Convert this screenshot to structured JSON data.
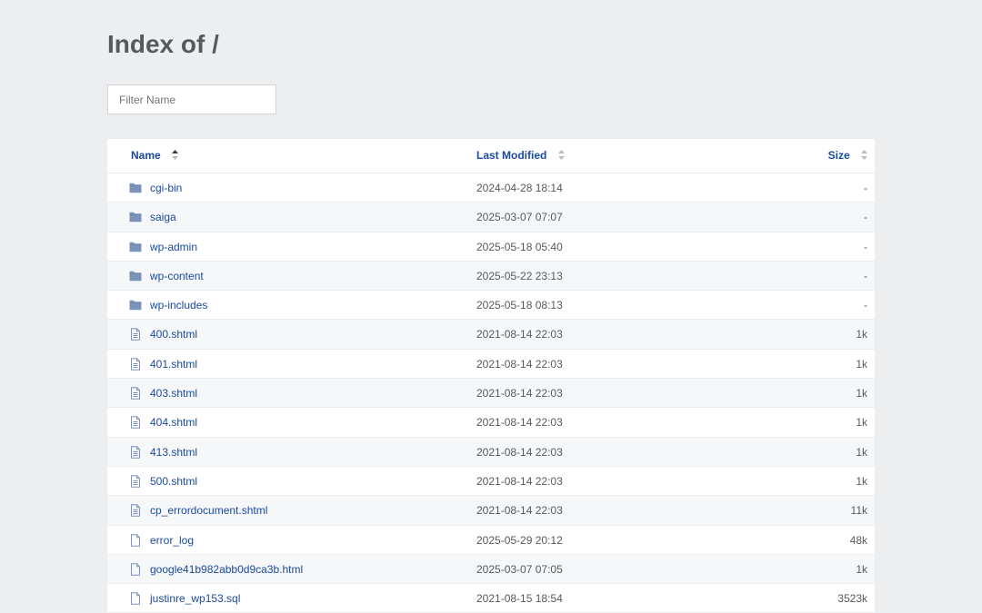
{
  "page": {
    "title": "Index of /"
  },
  "filter": {
    "placeholder": "Filter Name",
    "value": ""
  },
  "table": {
    "columns": {
      "name": "Name",
      "last_modified": "Last Modified",
      "size": "Size"
    },
    "rows": [
      {
        "type": "folder",
        "name": "cgi-bin",
        "modified": "2024-04-28 18:14",
        "size": "-"
      },
      {
        "type": "folder",
        "name": "saiga",
        "modified": "2025-03-07 07:07",
        "size": "-"
      },
      {
        "type": "folder",
        "name": "wp-admin",
        "modified": "2025-05-18 05:40",
        "size": "-"
      },
      {
        "type": "folder",
        "name": "wp-content",
        "modified": "2025-05-22 23:13",
        "size": "-"
      },
      {
        "type": "folder",
        "name": "wp-includes",
        "modified": "2025-05-18 08:13",
        "size": "-"
      },
      {
        "type": "file-text",
        "name": "400.shtml",
        "modified": "2021-08-14 22:03",
        "size": "1k"
      },
      {
        "type": "file-text",
        "name": "401.shtml",
        "modified": "2021-08-14 22:03",
        "size": "1k"
      },
      {
        "type": "file-text",
        "name": "403.shtml",
        "modified": "2021-08-14 22:03",
        "size": "1k"
      },
      {
        "type": "file-text",
        "name": "404.shtml",
        "modified": "2021-08-14 22:03",
        "size": "1k"
      },
      {
        "type": "file-text",
        "name": "413.shtml",
        "modified": "2021-08-14 22:03",
        "size": "1k"
      },
      {
        "type": "file-text",
        "name": "500.shtml",
        "modified": "2021-08-14 22:03",
        "size": "1k"
      },
      {
        "type": "file-text",
        "name": "cp_errordocument.shtml",
        "modified": "2021-08-14 22:03",
        "size": "11k"
      },
      {
        "type": "file",
        "name": "error_log",
        "modified": "2025-05-29 20:12",
        "size": "48k"
      },
      {
        "type": "file",
        "name": "google41b982abb0d9ca3b.html",
        "modified": "2025-03-07 07:05",
        "size": "1k"
      },
      {
        "type": "file",
        "name": "justinre_wp153.sql",
        "modified": "2021-08-15 18:54",
        "size": "3523k"
      }
    ]
  },
  "colors": {
    "background": "#edeef0",
    "link": "#1b4aa0",
    "folder_icon": "#7b93b8",
    "text": "#555a5e"
  },
  "icons": {
    "folder": "folder-icon",
    "file-text": "file-text-icon",
    "file": "file-icon",
    "sort": "sort-arrows-icon"
  }
}
